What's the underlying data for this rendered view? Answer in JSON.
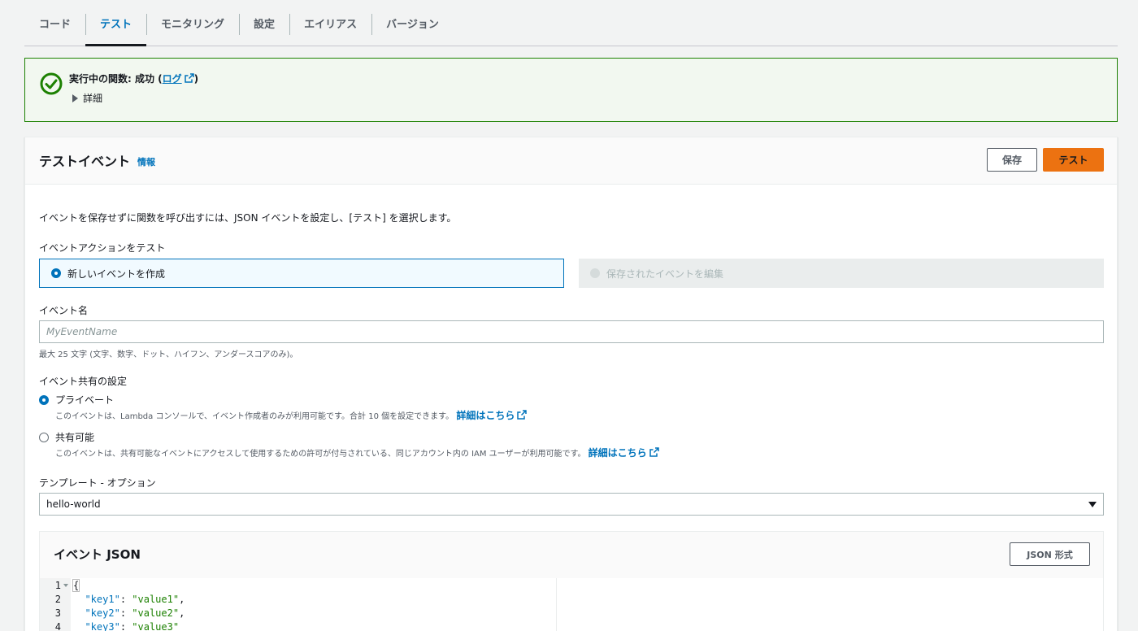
{
  "tabs": [
    {
      "label": "コード"
    },
    {
      "label": "テスト"
    },
    {
      "label": "モニタリング"
    },
    {
      "label": "設定"
    },
    {
      "label": "エイリアス"
    },
    {
      "label": "バージョン"
    }
  ],
  "alert": {
    "title_prefix": "実行中の関数: 成功 (",
    "log_link": "ログ",
    "title_suffix": ")",
    "details": "詳細",
    "status_color": "#1d8102"
  },
  "panel": {
    "title": "テストイベント",
    "info": "情報",
    "save_label": "保存",
    "test_label": "テスト",
    "description": "イベントを保存せずに関数を呼び出すには、JSON イベントを設定し、[テスト] を選択します。",
    "action_label": "イベントアクションをテスト",
    "option_new": "新しいイベントを作成",
    "option_saved": "保存されたイベントを編集",
    "event_name_label": "イベント名",
    "event_name_placeholder": "MyEventName",
    "event_name_hint": "最大 25 文字 (文字、数字、ドット、ハイフン、アンダースコアのみ)。",
    "sharing_label": "イベント共有の設定",
    "private_label": "プライベート",
    "private_desc": "このイベントは、Lambda コンソールで、イベント作成者のみが利用可能です。合計 10 個を設定できます。",
    "learn_more": "詳細はこちら",
    "shared_label": "共有可能",
    "shared_desc": "このイベントは、共有可能なイベントにアクセスして使用するための許可が付与されている、同じアカウント内の IAM ユーザーが利用可能です。",
    "template_label": "テンプレート - オプション",
    "template_value": "hello-world",
    "json_title": "イベント JSON",
    "json_format_label": "JSON 形式",
    "accent_color": "#ec7211",
    "link_color": "#0073bb"
  },
  "editor": {
    "lines": [
      {
        "num": "1",
        "open": "{"
      },
      {
        "num": "2",
        "key": "\"key1\"",
        "value": "\"value1\"",
        "sep": ","
      },
      {
        "num": "3",
        "key": "\"key2\"",
        "value": "\"value2\"",
        "sep": ","
      },
      {
        "num": "4",
        "key": "\"key3\"",
        "value": "\"value3\"",
        "sep": ""
      }
    ]
  }
}
